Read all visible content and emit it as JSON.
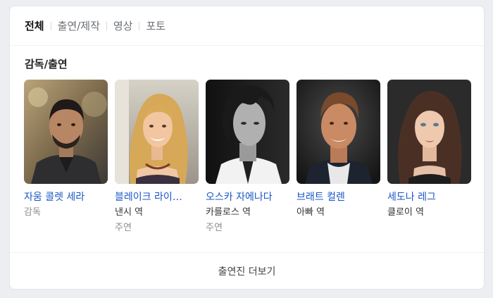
{
  "tabs": [
    {
      "label": "전체",
      "active": true
    },
    {
      "label": "출연/제작",
      "active": false
    },
    {
      "label": "영상",
      "active": false
    },
    {
      "label": "포토",
      "active": false
    }
  ],
  "section": {
    "title": "감독/출연"
  },
  "people": [
    {
      "name": "자움 콜렛 세라",
      "role": "감독",
      "extra": ""
    },
    {
      "name": "블레이크 라이…",
      "role": "낸시 역",
      "extra": "주연"
    },
    {
      "name": "오스카 자에나다",
      "role": "카를로스 역",
      "extra": "주연"
    },
    {
      "name": "브래트 컬렌",
      "role": "아빠 역",
      "extra": ""
    },
    {
      "name": "세도나 레그",
      "role": "클로이 역",
      "extra": ""
    }
  ],
  "more_label": "출연진 더보기",
  "colors": {
    "link": "#1a56c4",
    "active_tab": "#111111",
    "muted": "#8a8d92"
  }
}
